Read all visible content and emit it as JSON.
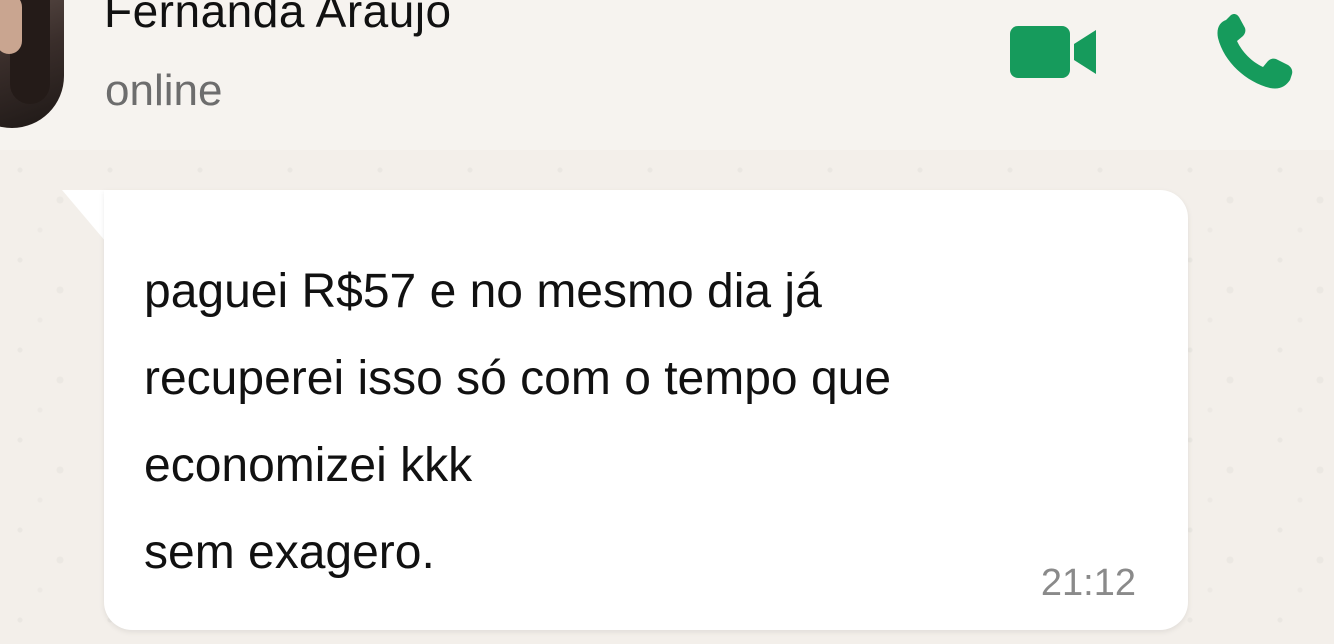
{
  "header": {
    "contact_name": "Fernanda Araujo",
    "status": "online",
    "icons": {
      "avatar": "contact-avatar",
      "video_call": "video-camera-icon",
      "voice_call": "phone-icon"
    },
    "accent_color": "#169b5c"
  },
  "messages": [
    {
      "text": "paguei R$57 e no mesmo dia já\nrecuperei isso só com o tempo que\neconomizei kkk\nsem exagero.",
      "time": "21:12",
      "direction": "incoming"
    }
  ]
}
